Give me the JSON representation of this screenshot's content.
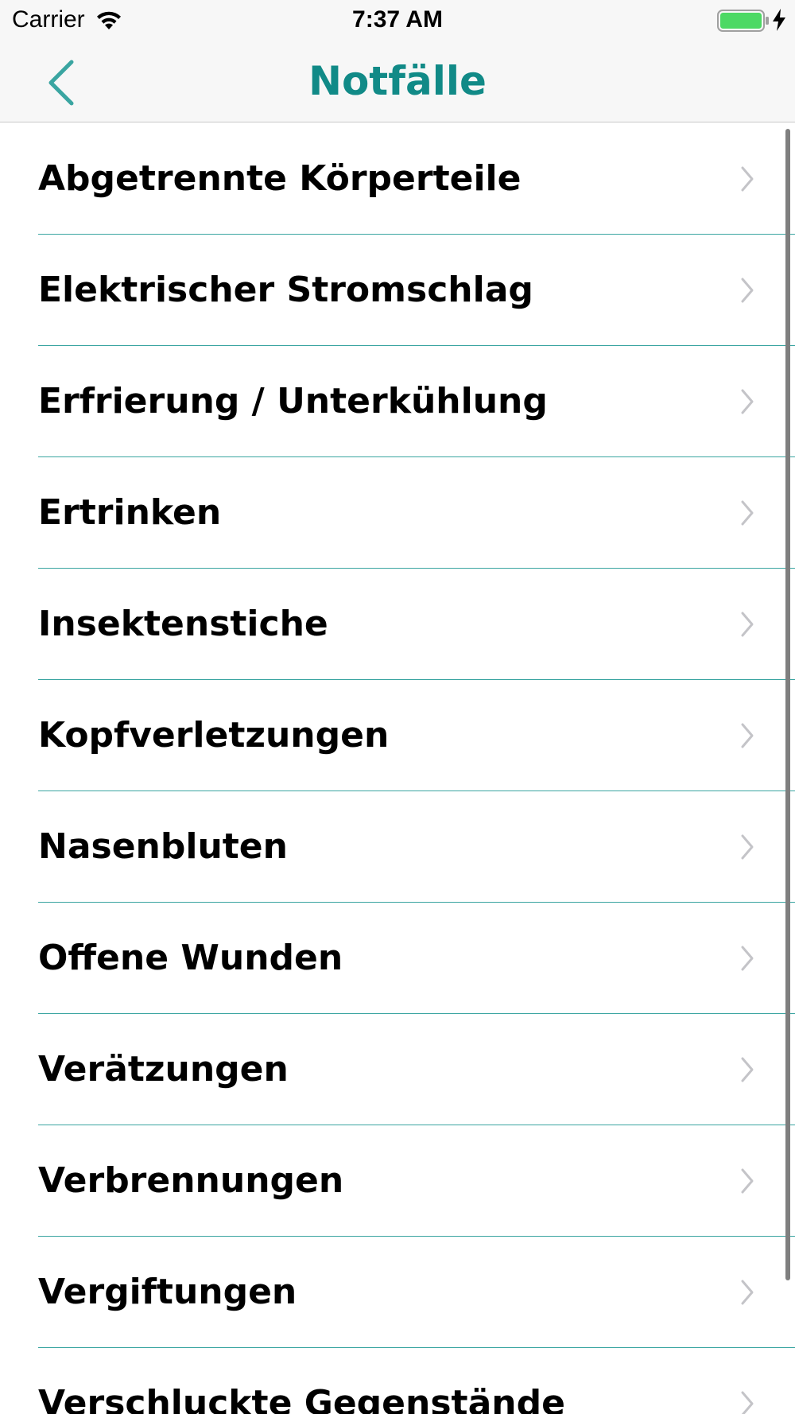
{
  "status_bar": {
    "carrier": "Carrier",
    "time": "7:37 AM",
    "battery_color": "#4cd964",
    "icons": [
      "wifi-icon",
      "battery-icon",
      "charging-bolt-icon"
    ]
  },
  "nav_bar": {
    "title": "Notfälle",
    "back_icon": "chevron-left-icon",
    "accent_color": "#118a87"
  },
  "list": {
    "separator_color": "#3aa5a1",
    "disclosure_icon": "chevron-right-icon",
    "items": [
      {
        "label": "Abgetrennte Körperteile"
      },
      {
        "label": "Elektrischer Stromschlag"
      },
      {
        "label": "Erfrierung / Unterkühlung"
      },
      {
        "label": "Ertrinken"
      },
      {
        "label": "Insektenstiche"
      },
      {
        "label": "Kopfverletzungen"
      },
      {
        "label": "Nasenbluten"
      },
      {
        "label": "Offene Wunden"
      },
      {
        "label": "Verätzungen"
      },
      {
        "label": "Verbrennungen"
      },
      {
        "label": "Vergiftungen"
      },
      {
        "label": "Verschluckte Gegenstände"
      }
    ]
  }
}
